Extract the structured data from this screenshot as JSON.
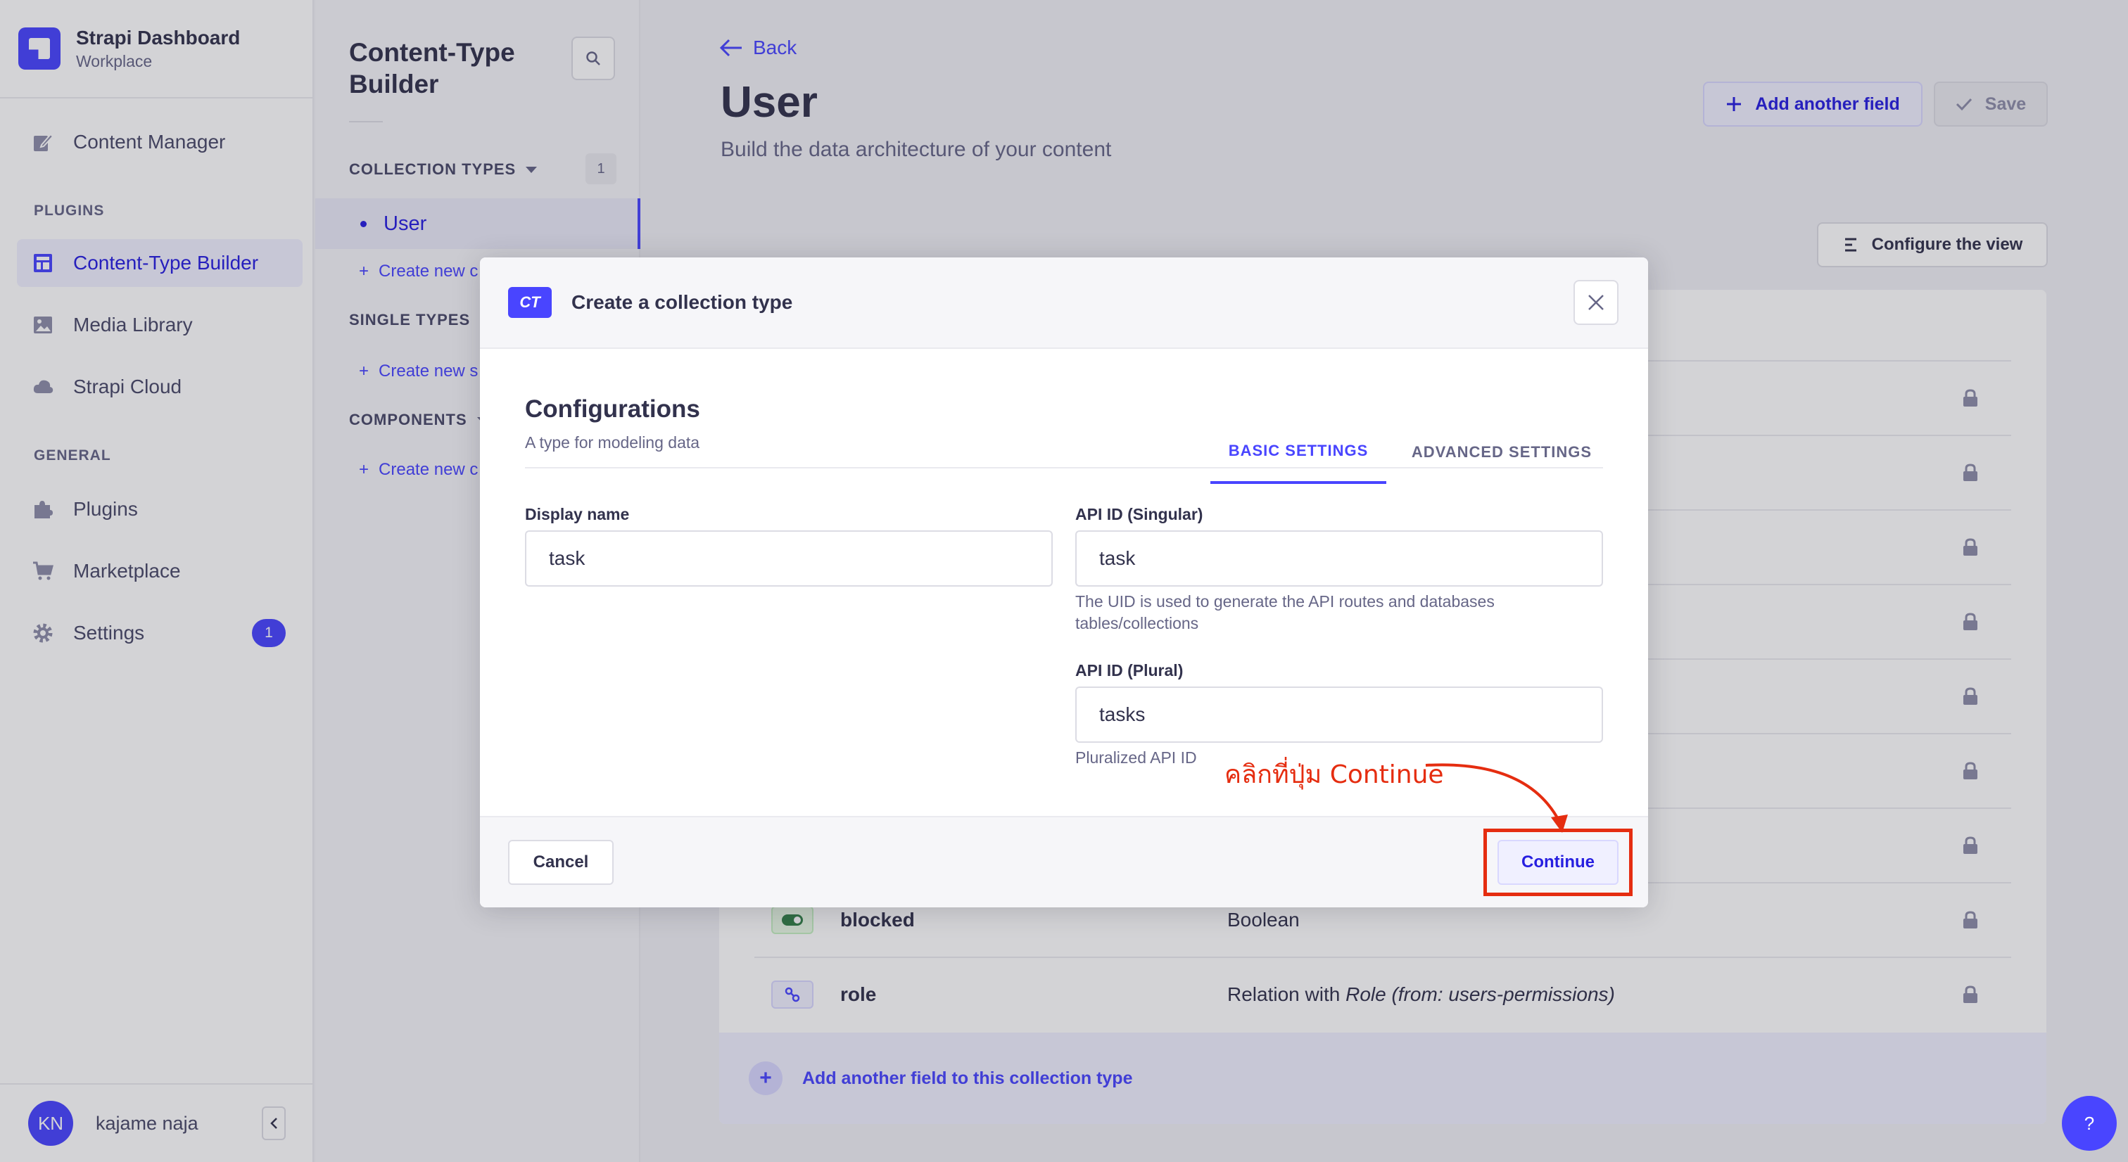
{
  "app": {
    "name": "Strapi Dashboard",
    "workspace": "Workplace"
  },
  "nav": {
    "content_manager": "Content Manager",
    "plugins_header": "PLUGINS",
    "content_type_builder": "Content-Type Builder",
    "media_library": "Media Library",
    "strapi_cloud": "Strapi Cloud",
    "general_header": "GENERAL",
    "plugins": "Plugins",
    "marketplace": "Marketplace",
    "settings": "Settings",
    "settings_badge": "1"
  },
  "user": {
    "initials": "KN",
    "name": "kajame naja"
  },
  "subnav": {
    "title": "Content-Type Builder",
    "collection_types": "COLLECTION TYPES",
    "collection_count": "1",
    "active_item": "User",
    "create_new_collection": "Create new c",
    "single_types": "SINGLE TYPES",
    "create_new_single": "Create new s",
    "components": "COMPONENTS",
    "create_new_component": "Create new c"
  },
  "header": {
    "back": "Back",
    "title": "User",
    "subtitle": "Build the data architecture of your content",
    "add_field_button": "Add another field",
    "save_button": "Save",
    "configure_view": "Configure the view"
  },
  "fields": [
    {
      "name": "blocked",
      "type": "Boolean",
      "icon": "toggle-icon"
    },
    {
      "name": "role",
      "type": "Relation with ",
      "type_em": "Role (from: users-permissions)",
      "icon": "relation-icon"
    }
  ],
  "add_field_row": "Add another field to this collection type",
  "help": "?",
  "modal": {
    "badge": "CT",
    "title": "Create a collection type",
    "section_title": "Configurations",
    "section_subtitle": "A type for modeling data",
    "tabs": [
      "BASIC SETTINGS",
      "ADVANCED SETTINGS"
    ],
    "display_name_label": "Display name",
    "display_name_value": "task",
    "api_singular_label": "API ID (Singular)",
    "api_singular_value": "task",
    "api_singular_hint": "The UID is used to generate the API routes and databases tables/collections",
    "api_plural_label": "API ID (Plural)",
    "api_plural_value": "tasks",
    "api_plural_hint": "Pluralized API ID",
    "cancel": "Cancel",
    "continue": "Continue"
  },
  "annotation": {
    "text": "คลิกที่ปุ่ม Continue",
    "color": "#e52d10"
  },
  "colors": {
    "primary": "#4945ff",
    "primary_dark": "#271fe0",
    "text": "#32324d",
    "muted": "#666687"
  }
}
